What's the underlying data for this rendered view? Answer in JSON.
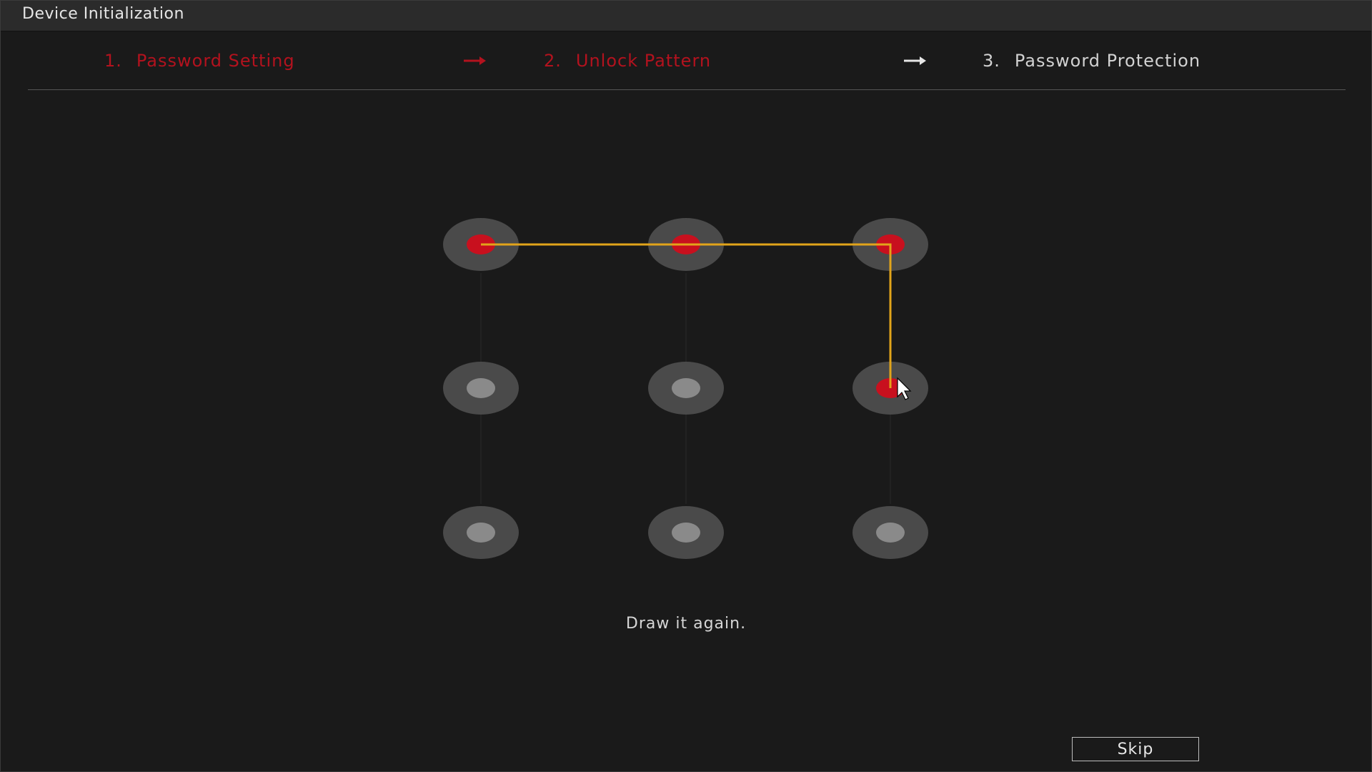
{
  "window": {
    "title": "Device Initialization"
  },
  "steps": [
    {
      "number": "1.",
      "label": "Password Setting",
      "state": "done"
    },
    {
      "number": "2.",
      "label": "Unlock Pattern",
      "state": "current"
    },
    {
      "number": "3.",
      "label": "Password Protection",
      "state": "pending"
    }
  ],
  "pattern": {
    "grid": "3x3",
    "selected_dots": [
      1,
      2,
      3,
      6
    ],
    "dot_color_selected": "#c8101e",
    "dot_color_idle": "#8a8a8a",
    "dot_ring_color": "#4a4a4a",
    "line_color": "#e2a41a"
  },
  "message": "Draw it again.",
  "buttons": {
    "skip_label": "Skip"
  },
  "colors": {
    "accent": "#b3121e",
    "background": "#1a1a1a"
  }
}
